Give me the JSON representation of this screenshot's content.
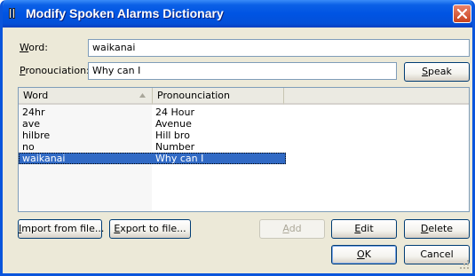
{
  "window": {
    "title": "Modify Spoken Alarms Dictionary"
  },
  "form": {
    "word_label_key": "W",
    "word_label_rest": "ord:",
    "word_value": "waikanai",
    "pron_label_key": "P",
    "pron_label_rest": "ronouciation:",
    "pron_value": "Why can I",
    "speak_button_key": "S",
    "speak_button_rest": "peak"
  },
  "list": {
    "columns": [
      "Word",
      "Pronounciation"
    ],
    "sort_indicator": "ascending",
    "rows": [
      {
        "word": "24hr",
        "pron": "24 Hour",
        "selected": false
      },
      {
        "word": "ave",
        "pron": "Avenue",
        "selected": false
      },
      {
        "word": "hilbre",
        "pron": "Hill bro",
        "selected": false
      },
      {
        "word": "no",
        "pron": "Number",
        "selected": false
      },
      {
        "word": "waikanai",
        "pron": "Why can I",
        "selected": true
      }
    ]
  },
  "buttons": {
    "import_key": "I",
    "import_rest": "mport from file...",
    "export_key": "E",
    "export_rest": "xport to file...",
    "add_key": "A",
    "add_rest": "dd",
    "edit_key": "E",
    "edit_rest": "dit",
    "delete_key": "D",
    "delete_rest": "elete",
    "ok_key": "O",
    "ok_rest": "K",
    "cancel": "Cancel"
  },
  "colors": {
    "titlebar": "#0054E3",
    "selection": "#316AC5",
    "dialog_bg": "#ECE9D8"
  }
}
